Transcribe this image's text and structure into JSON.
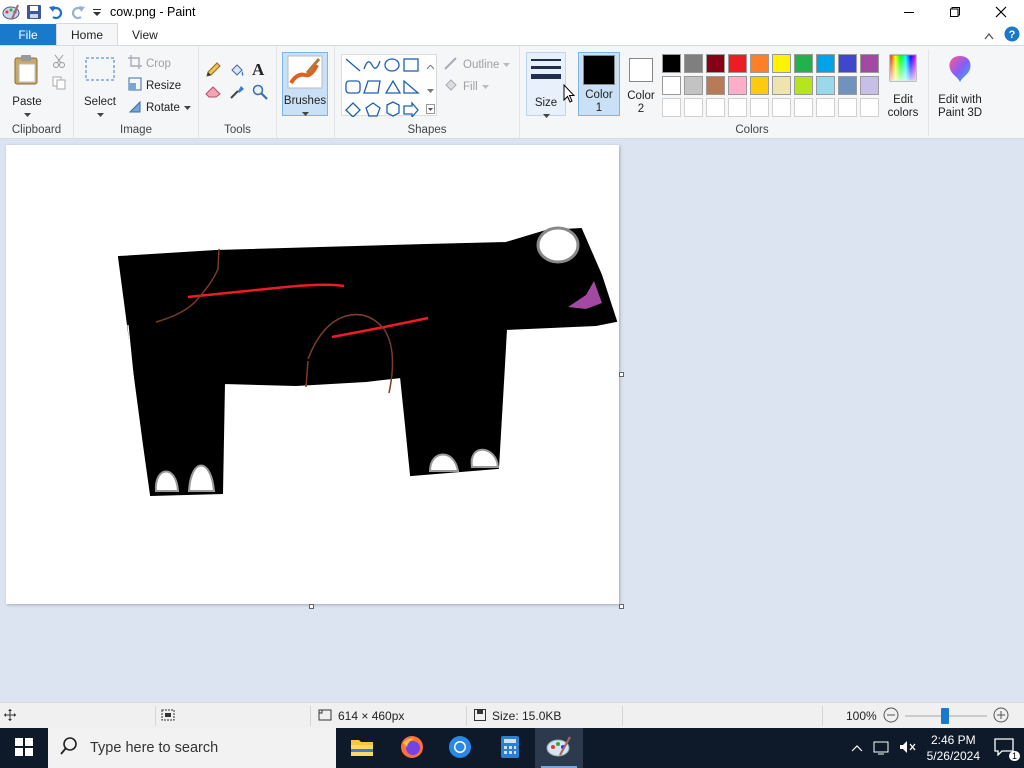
{
  "window": {
    "title": "cow.png - Paint"
  },
  "tabs": {
    "file": "File",
    "home": "Home",
    "view": "View"
  },
  "ribbon": {
    "clipboard": {
      "label": "Clipboard",
      "paste": "Paste"
    },
    "image": {
      "label": "Image",
      "select": "Select",
      "crop": "Crop",
      "resize": "Resize",
      "rotate": "Rotate"
    },
    "tools": {
      "label": "Tools"
    },
    "brushes": {
      "label": "Brushes"
    },
    "shapes": {
      "label": "Shapes",
      "outline": "Outline",
      "fill": "Fill"
    },
    "size": {
      "label": "Size"
    },
    "color1": {
      "line1": "Color",
      "line2": "1",
      "value": "#000000"
    },
    "color2": {
      "line1": "Color",
      "line2": "2",
      "value": "#ffffff"
    },
    "colors": {
      "label": "Colors",
      "edit_line1": "Edit",
      "edit_line2": "colors",
      "row1": [
        "#000000",
        "#7f7f7f",
        "#880015",
        "#ed1c24",
        "#ff7f27",
        "#fff200",
        "#22b14c",
        "#00a2e8",
        "#3f48cc",
        "#a349a4"
      ],
      "row2": [
        "#ffffff",
        "#c3c3c3",
        "#b97a57",
        "#ffaec9",
        "#ffc90e",
        "#efe4b0",
        "#b5e61d",
        "#99d9ea",
        "#7092be",
        "#c8bfe7"
      ],
      "row3": [
        "#ffffff",
        "#ffffff",
        "#ffffff",
        "#ffffff",
        "#ffffff",
        "#ffffff",
        "#ffffff",
        "#ffffff",
        "#ffffff",
        "#ffffff"
      ]
    },
    "paint3d": {
      "line1": "Edit with",
      "line2": "Paint 3D"
    }
  },
  "status": {
    "dimensions": "614 × 460px",
    "size": "Size: 15.0KB",
    "zoom": "100%"
  },
  "taskbar": {
    "search_placeholder": "Type here to search",
    "time": "2:46 PM",
    "date": "5/26/2024",
    "notifications": "1"
  }
}
